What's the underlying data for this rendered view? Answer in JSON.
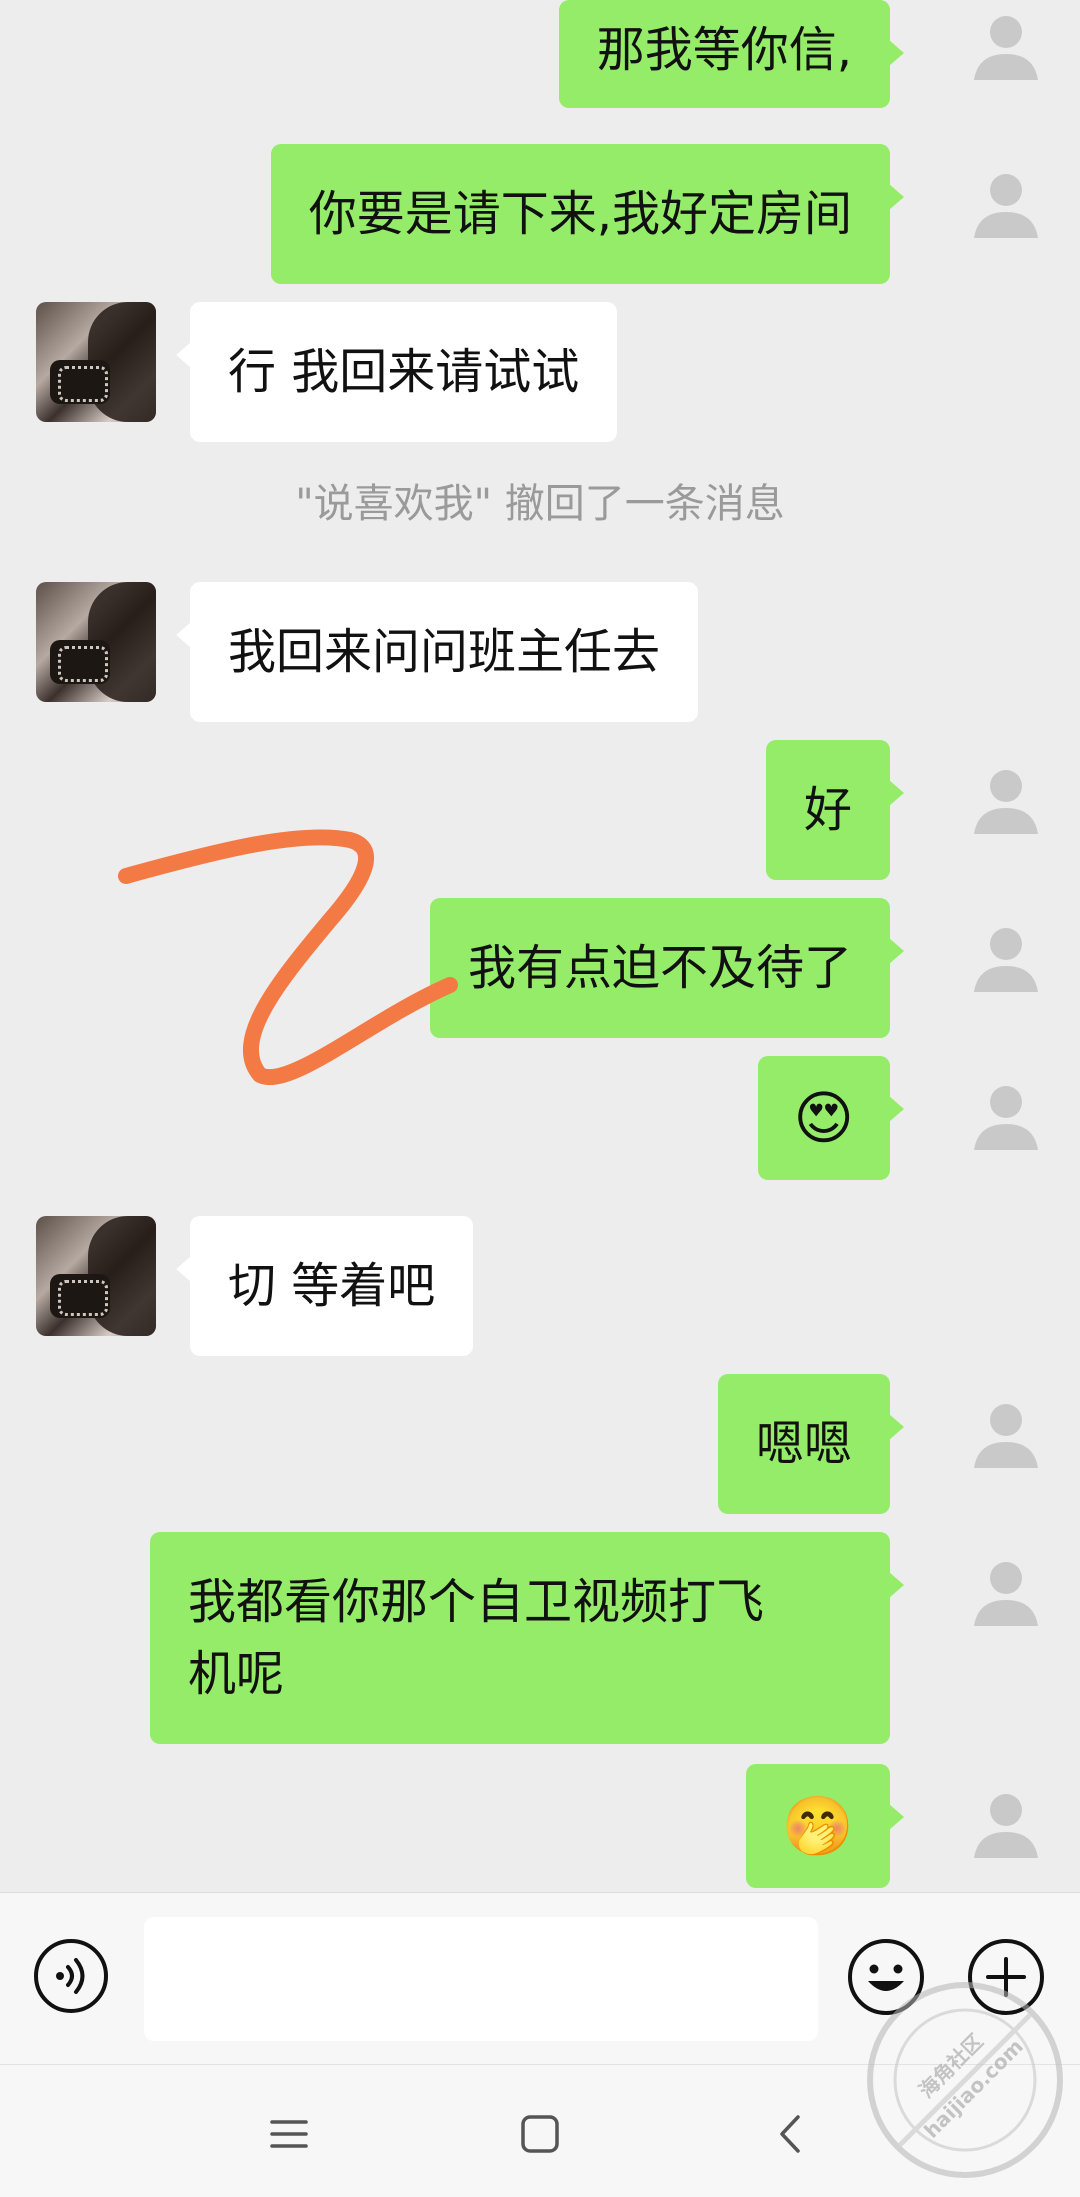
{
  "messages": [
    {
      "side": "out",
      "text": "那我等你信,"
    },
    {
      "side": "out",
      "text": "你要是请下来,我好定房间"
    },
    {
      "side": "in",
      "text": "行 我回来请试试"
    },
    {
      "side": "system",
      "text": "\"说喜欢我\" 撤回了一条消息"
    },
    {
      "side": "in",
      "text": "我回来问问班主任去"
    },
    {
      "side": "out",
      "text": "好"
    },
    {
      "side": "out",
      "text": "我有点迫不及待了"
    },
    {
      "side": "out",
      "text": "😍"
    },
    {
      "side": "in",
      "text": "切 等着吧"
    },
    {
      "side": "out",
      "text": "嗯嗯"
    },
    {
      "side": "out",
      "line1": "我都看你那个自卫视频打飞",
      "line2": "机呢"
    },
    {
      "side": "out",
      "text": "🤭"
    }
  ],
  "input_bar": {
    "message_value": "",
    "voice_icon": "voice-icon",
    "emoji_icon": "smiley-icon",
    "more_icon": "plus-icon"
  },
  "nav_bar": {
    "menu_icon": "menu-icon",
    "home_icon": "home-square-icon",
    "back_icon": "back-chevron-icon"
  },
  "watermark": {
    "line1": "海角社区",
    "line2": "haijiao.com"
  },
  "colors": {
    "outgoing_bubble": "#95ec69",
    "incoming_bubble": "#ffffff",
    "background": "#ededed",
    "scribble": "#f47a45"
  }
}
